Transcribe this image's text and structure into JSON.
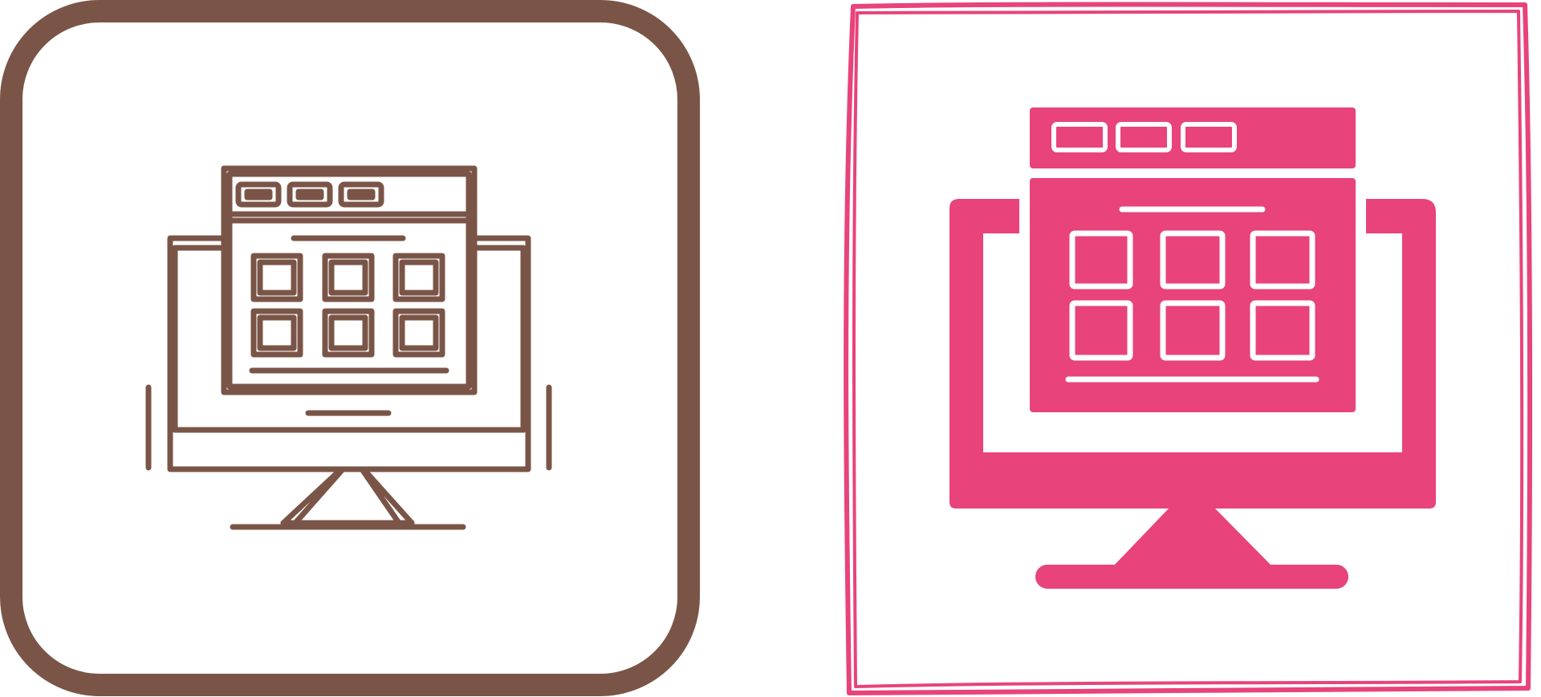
{
  "icons": [
    {
      "name": "monitor-web-grid-outline-icon",
      "style": "outline",
      "color": "#7a5547",
      "frame": "rounded-square"
    },
    {
      "name": "monitor-web-grid-glyph-icon",
      "style": "filled",
      "color": "#e8437a",
      "frame": "sketchy-square"
    }
  ],
  "colors": {
    "background": "#ffffff",
    "outline_brown": "#7a5547",
    "glyph_pink": "#e8437a"
  }
}
